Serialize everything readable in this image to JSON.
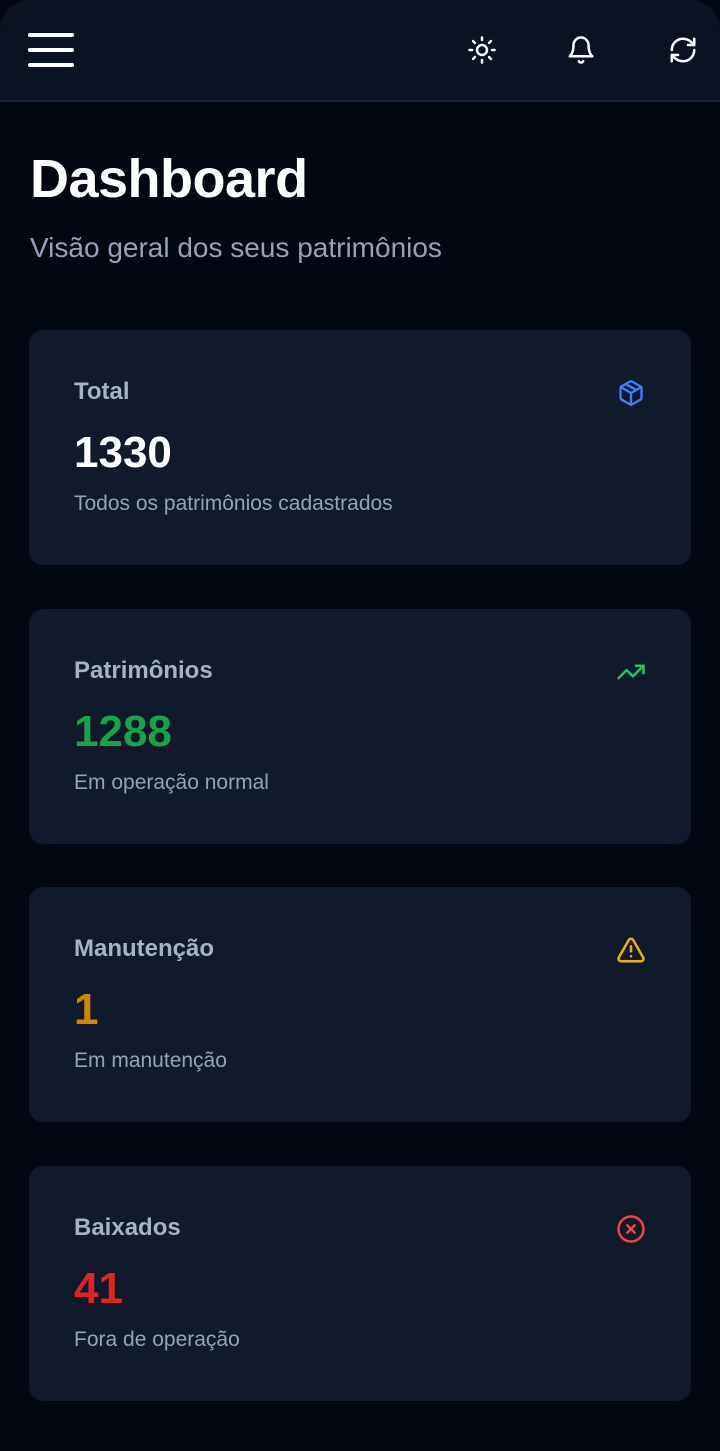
{
  "header": {
    "menu_icon": "hamburger-menu-icon",
    "theme_icon": "sun-icon",
    "notifications_icon": "bell-icon",
    "refresh_icon": "refresh-icon"
  },
  "page": {
    "title": "Dashboard",
    "subtitle": "Visão geral dos seus patrimônios"
  },
  "cards": [
    {
      "label": "Total",
      "value": "1330",
      "description": "Todos os patrimônios cadastrados",
      "icon": "package-icon",
      "color": "#ffffff",
      "icon_color": "#3b82f6"
    },
    {
      "label": "Patrimônios",
      "value": "1288",
      "description": "Em operação normal",
      "icon": "trending-up-icon",
      "color": "#16a34a",
      "icon_color": "#22c55e"
    },
    {
      "label": "Manutenção",
      "value": "1",
      "description": "Em manutenção",
      "icon": "warning-icon",
      "color": "#ca8a04",
      "icon_color": "#eab308"
    },
    {
      "label": "Baixados",
      "value": "41",
      "description": "Fora de operação",
      "icon": "x-circle-icon",
      "color": "#dc2626",
      "icon_color": "#ef4444"
    }
  ]
}
